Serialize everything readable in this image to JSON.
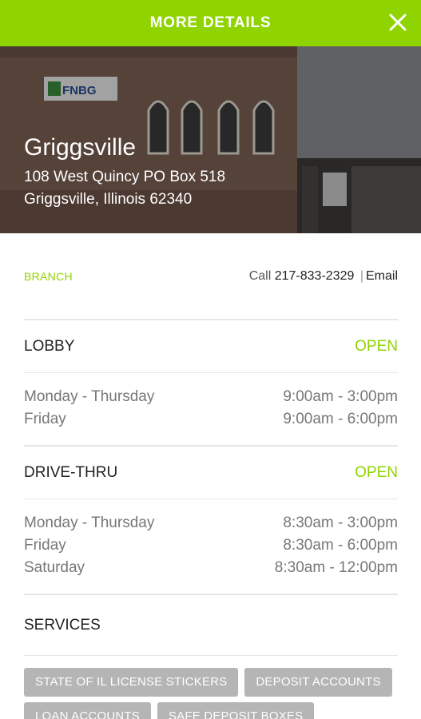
{
  "header": {
    "title": "MORE DETAILS",
    "close_icon": "close-icon",
    "background": "#8fd400"
  },
  "hero": {
    "branch_name": "Griggsville",
    "address_line1": "108 West Quincy PO Box 518",
    "address_line2": "Griggsville, Illinois 62340",
    "sign_text": "FNBG"
  },
  "branch": {
    "label": "BRANCH",
    "call_prefix": "Call",
    "phone": "217-833-2329",
    "separator": "|",
    "email_label": "Email"
  },
  "lobby": {
    "title": "LOBBY",
    "status": "OPEN",
    "hours": [
      {
        "days": "Monday - Thursday",
        "time": "9:00am - 3:00pm"
      },
      {
        "days": "Friday",
        "time": "9:00am - 6:00pm"
      }
    ]
  },
  "drive_thru": {
    "title": "DRIVE-THRU",
    "status": "OPEN",
    "hours": [
      {
        "days": "Monday - Thursday",
        "time": "8:30am - 3:00pm"
      },
      {
        "days": "Friday",
        "time": "8:30am - 6:00pm"
      },
      {
        "days": "Saturday",
        "time": "8:30am - 12:00pm"
      }
    ]
  },
  "services": {
    "title": "SERVICES",
    "items": [
      "STATE OF IL LICENSE STICKERS",
      "DEPOSIT ACCOUNTS",
      "LOAN ACCOUNTS",
      "SAFE DEPOSIT BOXES"
    ]
  },
  "colors": {
    "accent": "#8fd400",
    "chip": "#b5b5b5"
  }
}
